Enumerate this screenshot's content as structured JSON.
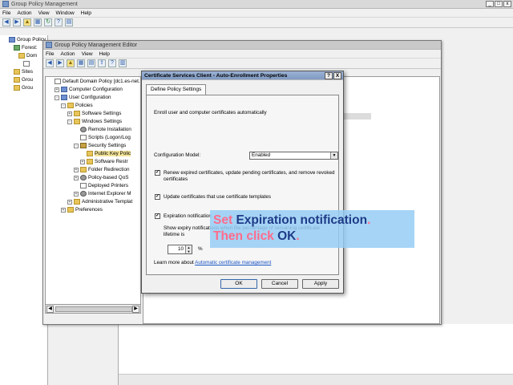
{
  "gpm": {
    "title": "Group Policy Management",
    "menu": [
      "File",
      "Action",
      "View",
      "Window",
      "Help"
    ],
    "tree": [
      {
        "label": "Group Policy",
        "icon": "blue"
      },
      {
        "label": "Forest:",
        "icon": "forest"
      },
      {
        "label": "Dom",
        "icon": "folder"
      },
      {
        "label": "",
        "icon": "doc"
      },
      {
        "label": "Sites",
        "icon": "folder"
      },
      {
        "label": "Grou",
        "icon": "folder"
      },
      {
        "label": "Grou",
        "icon": "folder"
      }
    ]
  },
  "editor": {
    "title": "Group Policy Management Editor",
    "menu": [
      "File",
      "Action",
      "View",
      "Help"
    ],
    "tree": [
      {
        "label": "Default Domain Policy [dc1.es-net.",
        "icon": "doc",
        "indent": 0,
        "exp": ""
      },
      {
        "label": "Computer Configuration",
        "icon": "blue",
        "indent": 1,
        "exp": "+"
      },
      {
        "label": "User Configuration",
        "icon": "blue",
        "indent": 1,
        "exp": "-"
      },
      {
        "label": "Policies",
        "icon": "folder",
        "indent": 2,
        "exp": "-"
      },
      {
        "label": "Software Settings",
        "icon": "folder",
        "indent": 3,
        "exp": "+"
      },
      {
        "label": "Windows Settings",
        "icon": "folder",
        "indent": 3,
        "exp": "-"
      },
      {
        "label": "Remote Installation",
        "icon": "gear",
        "indent": 4,
        "exp": ""
      },
      {
        "label": "Scripts (Logon/Log",
        "icon": "doc",
        "indent": 4,
        "exp": ""
      },
      {
        "label": "Security Settings",
        "icon": "sec",
        "indent": 4,
        "exp": "-"
      },
      {
        "label": "Public Key Polic",
        "icon": "folder",
        "indent": 5,
        "exp": "",
        "selected": true
      },
      {
        "label": "Software Restr",
        "icon": "folder",
        "indent": 5,
        "exp": "+"
      },
      {
        "label": "Folder Redirection",
        "icon": "folder",
        "indent": 4,
        "exp": "+"
      },
      {
        "label": "Policy-based QoS",
        "icon": "gear",
        "indent": 4,
        "exp": "+"
      },
      {
        "label": "Deployed Printers",
        "icon": "doc",
        "indent": 4,
        "exp": ""
      },
      {
        "label": "Internet Explorer M",
        "icon": "gear",
        "indent": 4,
        "exp": "+"
      },
      {
        "label": "Administrative Templat",
        "icon": "folder",
        "indent": 3,
        "exp": "+"
      },
      {
        "label": "Preferences",
        "icon": "folder",
        "indent": 2,
        "exp": "+"
      }
    ]
  },
  "dialog": {
    "title": "Certificate Services Client - Auto-Enrollment Properties",
    "help_btn": "?",
    "close_btn": "X",
    "tab": "Define Policy Settings",
    "intro": "Enroll user and computer certificates automatically",
    "config_model_label": "Configuration Model:",
    "config_model_value": "Enabled",
    "renew_label": "Renew expired certificates, update pending certificates, and remove revoked certificates",
    "update_label": "Update certificates that use certificate templates",
    "expiration_label": "Expiration notification",
    "expiry_desc": "Show expiry notifications when the percentage of remaining certificate lifetime is",
    "percent_value": "10",
    "percent_unit": "%",
    "learn_prefix": "Learn more about ",
    "learn_link": "Automatic certificate management",
    "ok": "OK",
    "cancel": "Cancel",
    "apply": "Apply"
  },
  "callout": {
    "w1": "Set ",
    "w2": "Expiration notification",
    "w3": ".",
    "w4": "Then click ",
    "w5": "OK",
    "w6": "."
  }
}
